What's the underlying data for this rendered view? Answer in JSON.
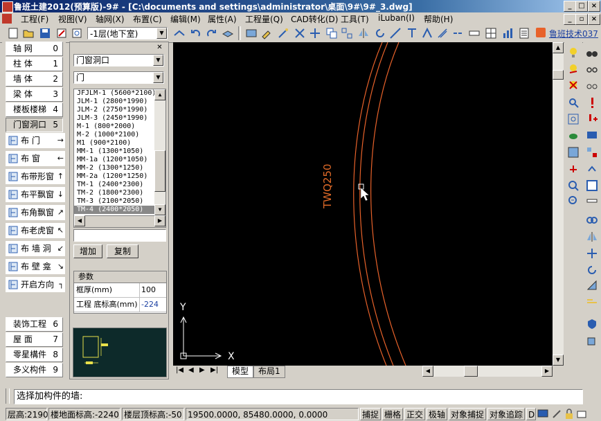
{
  "window": {
    "title": "鲁班土建2012(预算版)-9# - [C:\\documents and settings\\administrator\\桌面\\9#\\9#_3.dwg]"
  },
  "menu": [
    "工程(F)",
    "视图(V)",
    "轴网(X)",
    "布置(C)",
    "编辑(M)",
    "属性(A)",
    "工程量(Q)",
    "CAD转化(D)",
    "工具(T)",
    "iLuban(I)",
    "帮助(H)"
  ],
  "toolbar": {
    "floor_select": "-1层(地下室)",
    "tech_label": "鲁班技术037"
  },
  "left_nav": {
    "categories_top": [
      {
        "label": "轴   网",
        "num": "0"
      },
      {
        "label": "柱   体",
        "num": "1"
      },
      {
        "label": "墙   体",
        "num": "2"
      },
      {
        "label": "梁   体",
        "num": "3"
      },
      {
        "label": "楼板楼梯",
        "num": "4"
      },
      {
        "label": "门窗洞口",
        "num": "5"
      }
    ],
    "tools": [
      {
        "label": "布    门",
        "arrow": "→",
        "icon": "door-icon"
      },
      {
        "label": "布    窗",
        "arrow": "←",
        "icon": "window-icon"
      },
      {
        "label": "布带形窗",
        "arrow": "↑",
        "icon": "strip-window-icon"
      },
      {
        "label": "布平飘窗",
        "arrow": "↓",
        "icon": "bay-window-icon"
      },
      {
        "label": "布角飘窗",
        "arrow": "↗",
        "icon": "corner-bay-window-icon"
      },
      {
        "label": "布老虎窗",
        "arrow": "↖",
        "icon": "dormer-window-icon"
      },
      {
        "label": "布 墙 洞",
        "arrow": "↙",
        "icon": "wall-hole-icon"
      },
      {
        "label": "布 壁 龛",
        "arrow": "↘",
        "icon": "niche-icon"
      },
      {
        "label": "开启方向",
        "arrow": "┐",
        "icon": "open-direction-icon"
      }
    ],
    "categories_bottom": [
      {
        "label": "装饰工程",
        "num": "6"
      },
      {
        "label": "屋   面",
        "num": "7"
      },
      {
        "label": "零星構件",
        "num": "8"
      },
      {
        "label": "多义构件",
        "num": "9"
      }
    ]
  },
  "prop_panel": {
    "category_select": "门窗洞口",
    "type_select": "门",
    "types": [
      "JFJLM-1 (5600*2100)",
      "JLM-1 (2800*1990)",
      "JLM-2 (2750*1990)",
      "JLM-3 (2450*1990)",
      "M-1 (800*2000)",
      "M-2 (1000*2100)",
      "M1 (900*2100)",
      "MM-1 (1300*1050)",
      "MM-1a (1200*1050)",
      "MM-2 (1300*1250)",
      "MM-2a (1200*1250)",
      "TM-1 (2400*2300)",
      "TM-2 (1800*2300)",
      "TM-3 (2100*2050)",
      "TM-4 (2400*2050)"
    ],
    "selected_type": "TM-4 (2400*2050)",
    "add_button": "增加",
    "copy_button": "复制",
    "param_header": "参数",
    "params": [
      {
        "key": "框厚(mm)",
        "value": "100"
      },
      {
        "key": "工程 底标高(mm)",
        "value": "-224"
      }
    ]
  },
  "canvas": {
    "wall_label": "TWQ250",
    "axis_y": "Y",
    "axis_x": "X",
    "tab_model": "模型",
    "tab_layout": "布局1"
  },
  "command": {
    "prompt": "选择加构件的墙:"
  },
  "status": {
    "floor_height": "层高:2190",
    "floor_base": "楼地面标高:-2240",
    "floor_top": "楼层顶标高:-50",
    "coords": "19500.0000, 85480.0000, 0.0000",
    "buttons": [
      "捕捉",
      "栅格",
      "正交",
      "极轴",
      "对象捕捉",
      "对象追踪",
      "D"
    ]
  },
  "colors": {
    "canvas_bg": "#000000",
    "wall_line": "#e8622a",
    "wall_text": "#e06a28",
    "title_bg": "#0a246a"
  }
}
